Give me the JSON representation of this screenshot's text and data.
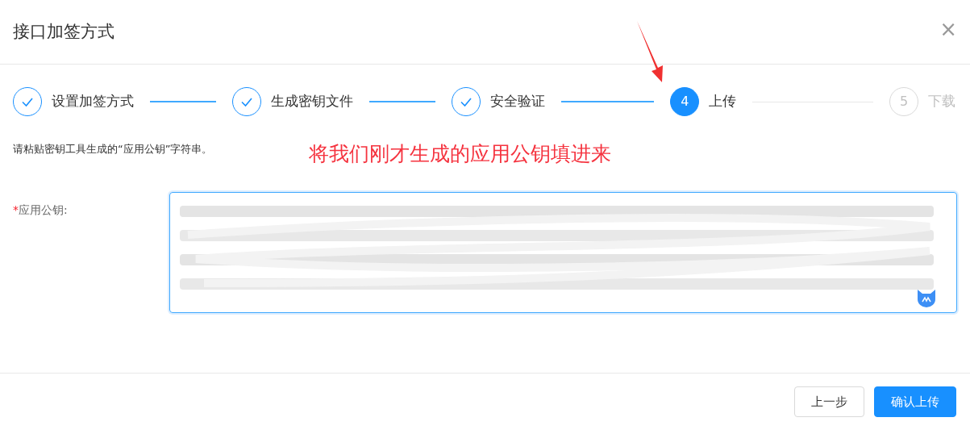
{
  "dialog": {
    "title": "接口加签方式",
    "close": "×"
  },
  "steps": [
    {
      "label": "设置加签方式",
      "kind": "done"
    },
    {
      "label": "生成密钥文件",
      "kind": "done"
    },
    {
      "label": "安全验证",
      "kind": "done"
    },
    {
      "number": "4",
      "label": "上传",
      "kind": "active"
    },
    {
      "number": "5",
      "label": "下载",
      "kind": "wait"
    }
  ],
  "hint": "请粘贴密钥工具生成的“应用公钥”字符串。",
  "annotation": "将我们刚才生成的应用公钥填进来",
  "field": {
    "required_mark": "*",
    "label": "应用公钥:",
    "value_obscured": true
  },
  "buttons": [
    {
      "label": "上一步",
      "kind": "secondary"
    },
    {
      "label": "确认上传",
      "kind": "primary"
    }
  ]
}
